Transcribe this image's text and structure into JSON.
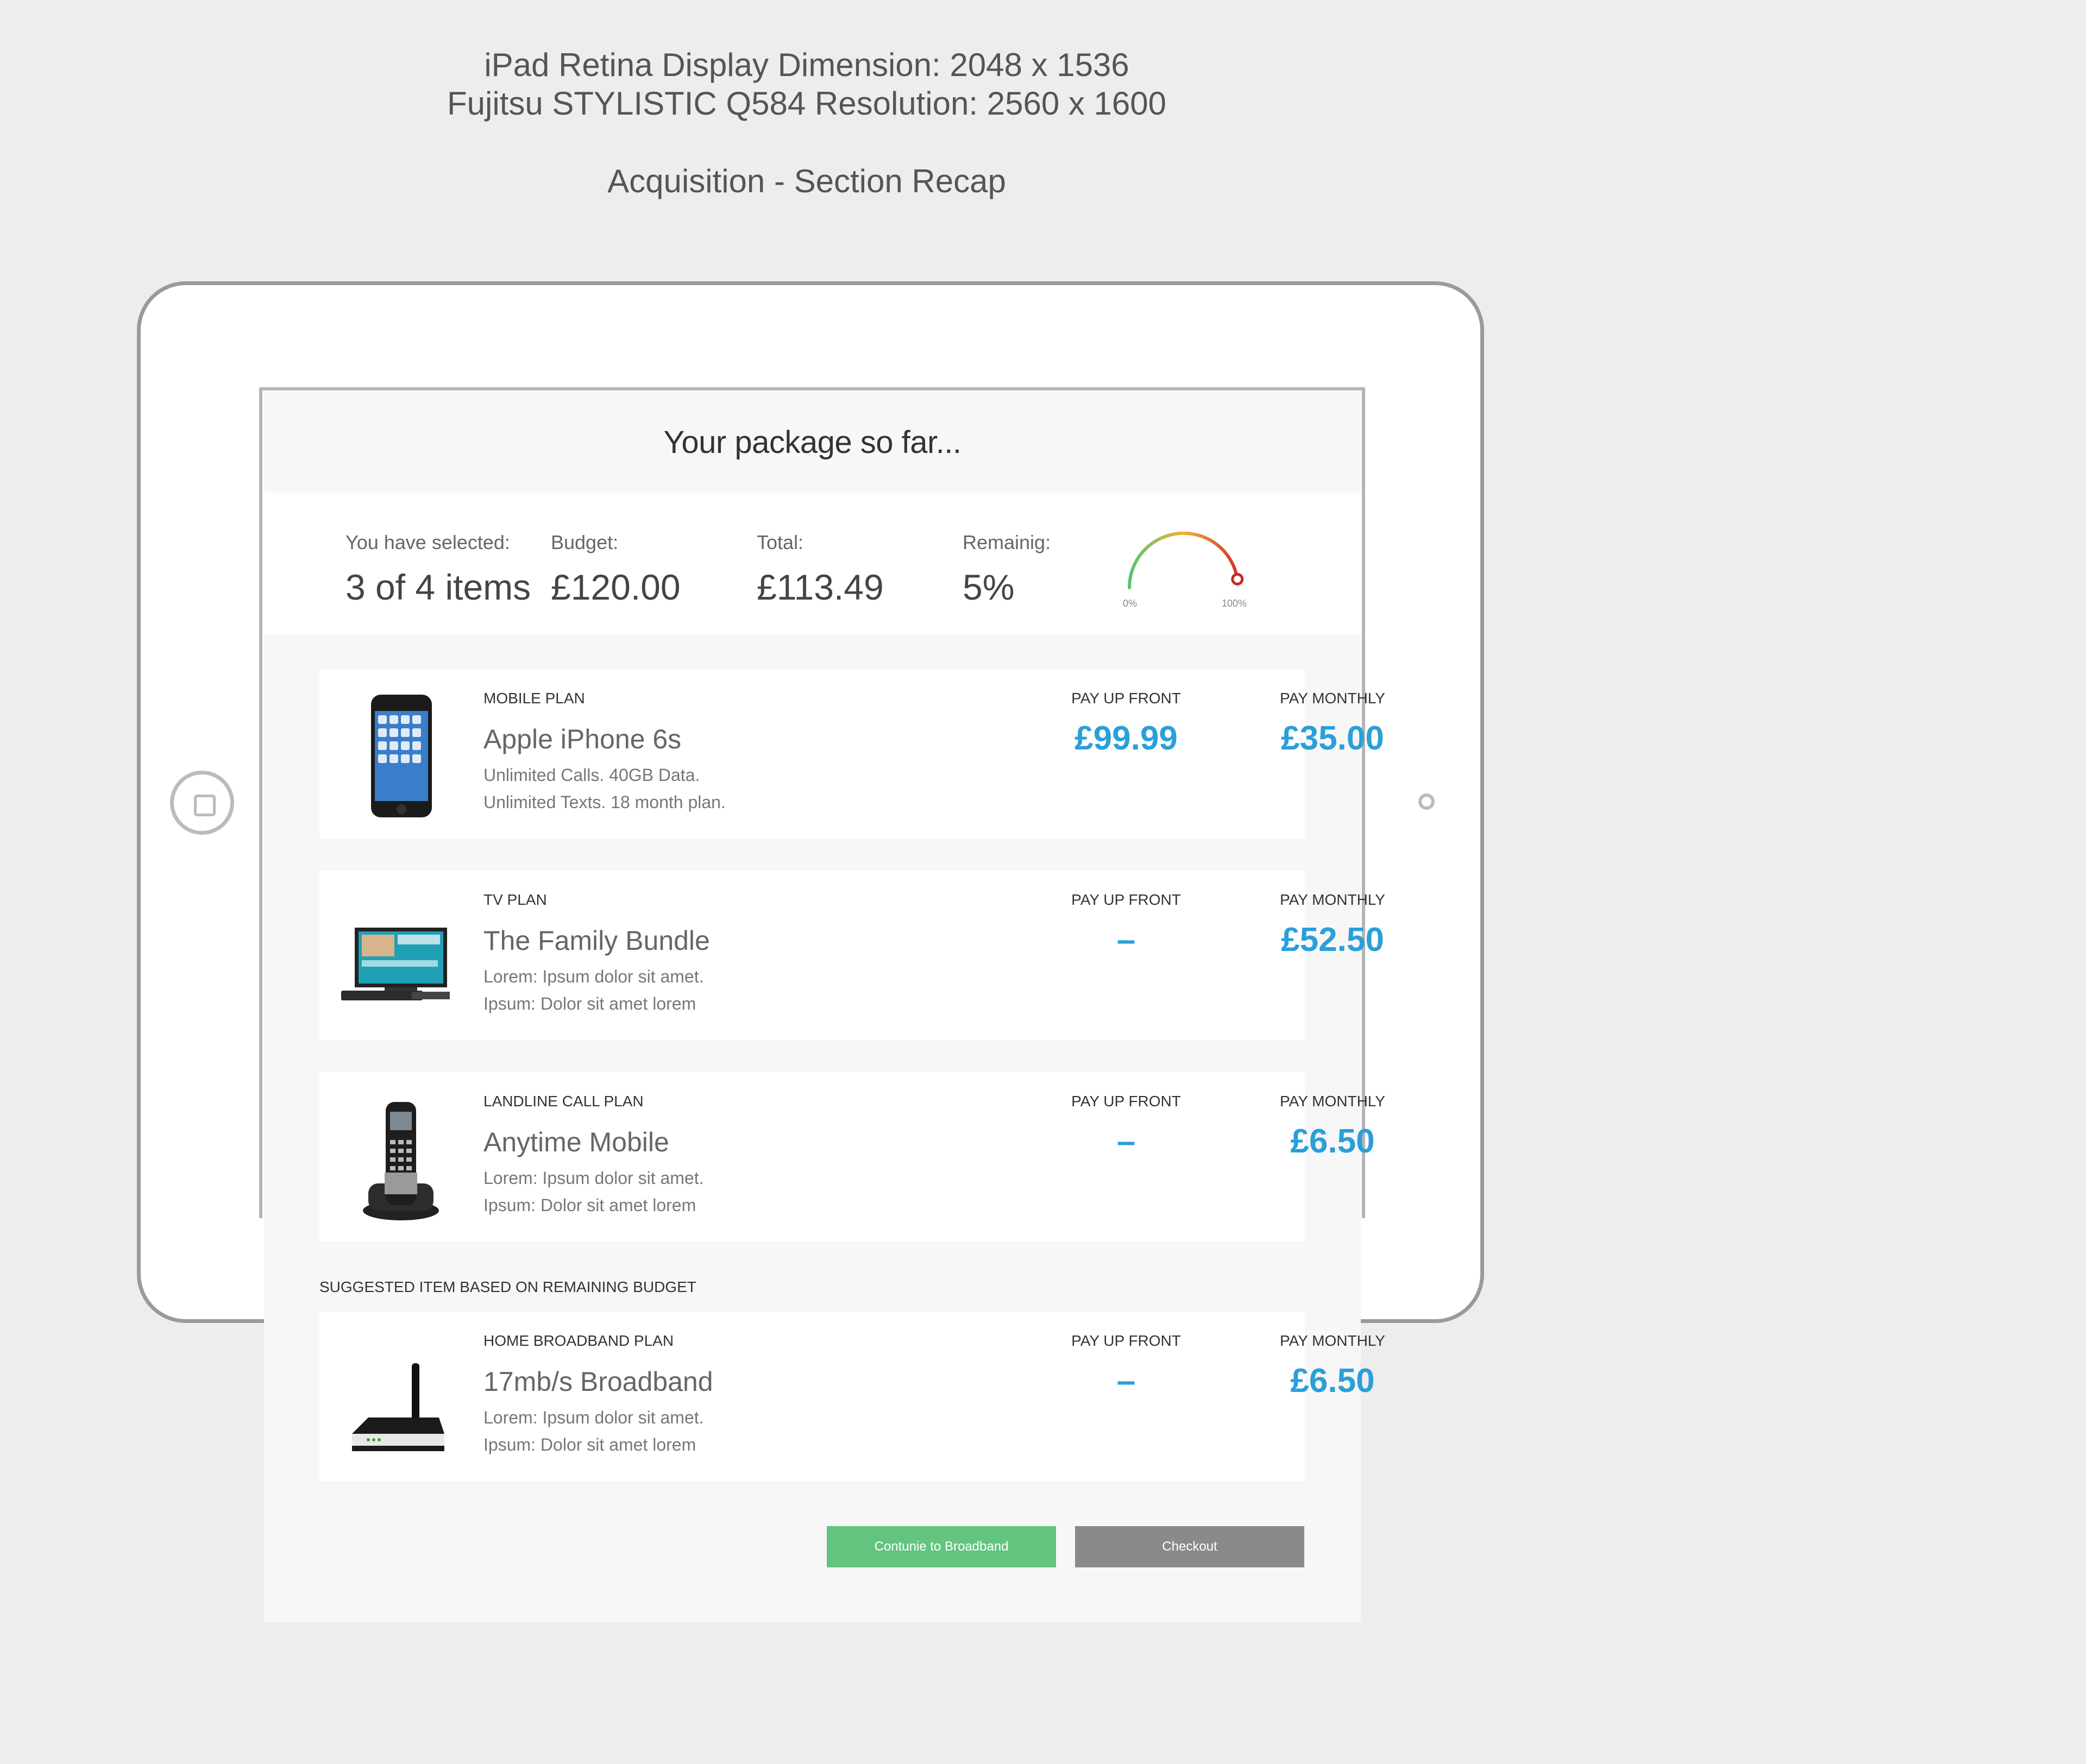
{
  "meta": {
    "line1": "iPad Retina Display Dimension: 2048 x 1536",
    "line2": "Fujitsu STYLISTIC Q584 Resolution: 2560 x 1600",
    "section": "Acquisition - Section Recap"
  },
  "header": {
    "title": "Your package so far..."
  },
  "summary": {
    "selected_label": "You have selected:",
    "selected_value": "3 of 4 items",
    "budget_label": "Budget:",
    "budget_value": "£120.00",
    "total_label": "Total:",
    "total_value": "£113.49",
    "remaining_label": "Remainig:",
    "remaining_value": "5%",
    "gauge_min_label": "0%",
    "gauge_max_label": "100%",
    "gauge_used_fraction": 0.95
  },
  "cards": [
    {
      "type": "MOBILE PLAN",
      "name": "Apple iPhone 6s",
      "desc1": "Unlimited Calls. 40GB Data.",
      "desc2": "Unlimited Texts. 18 month plan.",
      "front_label": "PAY UP FRONT",
      "front_value": "£99.99",
      "monthly_label": "PAY MONTHLY",
      "monthly_value": "£35.00",
      "icon": "smartphone-icon"
    },
    {
      "type": "TV PLAN",
      "name": "The Family Bundle",
      "desc1": "Lorem: Ipsum dolor sit amet.",
      "desc2": "Ipsum: Dolor sit amet lorem",
      "front_label": "PAY UP FRONT",
      "front_value": "–",
      "monthly_label": "PAY MONTHLY",
      "monthly_value": "£52.50",
      "icon": "tv-icon"
    },
    {
      "type": "LANDLINE CALL PLAN",
      "name": "Anytime Mobile",
      "desc1": "Lorem: Ipsum dolor sit amet.",
      "desc2": "Ipsum: Dolor sit amet lorem",
      "front_label": "PAY UP FRONT",
      "front_value": "–",
      "monthly_label": "PAY MONTHLY",
      "monthly_value": "£6.50",
      "icon": "cordless-phone-icon"
    }
  ],
  "suggestion": {
    "label": "SUGGESTED ITEM BASED ON REMAINING BUDGET",
    "card": {
      "type": "HOME BROADBAND PLAN",
      "name": "17mb/s Broadband",
      "desc1": "Lorem: Ipsum dolor sit amet.",
      "desc2": "Ipsum: Dolor sit amet lorem",
      "front_label": "PAY UP FRONT",
      "front_value": "–",
      "monthly_label": "PAY MONTHLY",
      "monthly_value": "£6.50",
      "icon": "router-icon"
    }
  },
  "actions": {
    "continue_label": "Contunie to Broadband",
    "checkout_label": "Checkout"
  },
  "colors": {
    "price": "#2a9fd8",
    "continue_button": "#62c47f",
    "checkout_button": "#8a8a8a"
  }
}
